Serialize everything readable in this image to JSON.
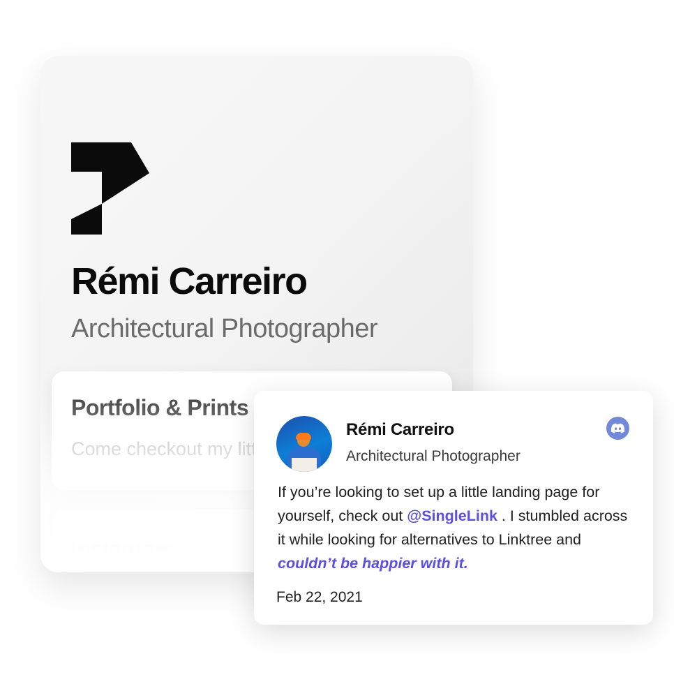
{
  "profile": {
    "name": "Rémi Carreiro",
    "title": "Architectural Photographer",
    "links": [
      {
        "title": "Portfolio & Prints",
        "subtitle": "Come checkout my little corner of the internet"
      },
      {
        "title": "Instagram"
      }
    ]
  },
  "testimonial": {
    "author_name": "Rémi Carreiro",
    "author_title": "Architectural Photographer",
    "platform_icon": "discord-icon",
    "body_before": "If you’re looking to set up a little landing page for yourself, check out ",
    "mention": "@SingleLink",
    "body_middle": " . I stumbled across it while looking for alternatives to Linktree and ",
    "emphasis": "couldn’t be happier with it.",
    "date": "Feb 22, 2021",
    "accent_color": "#5a4fe0",
    "discord_color": "#7289da"
  }
}
